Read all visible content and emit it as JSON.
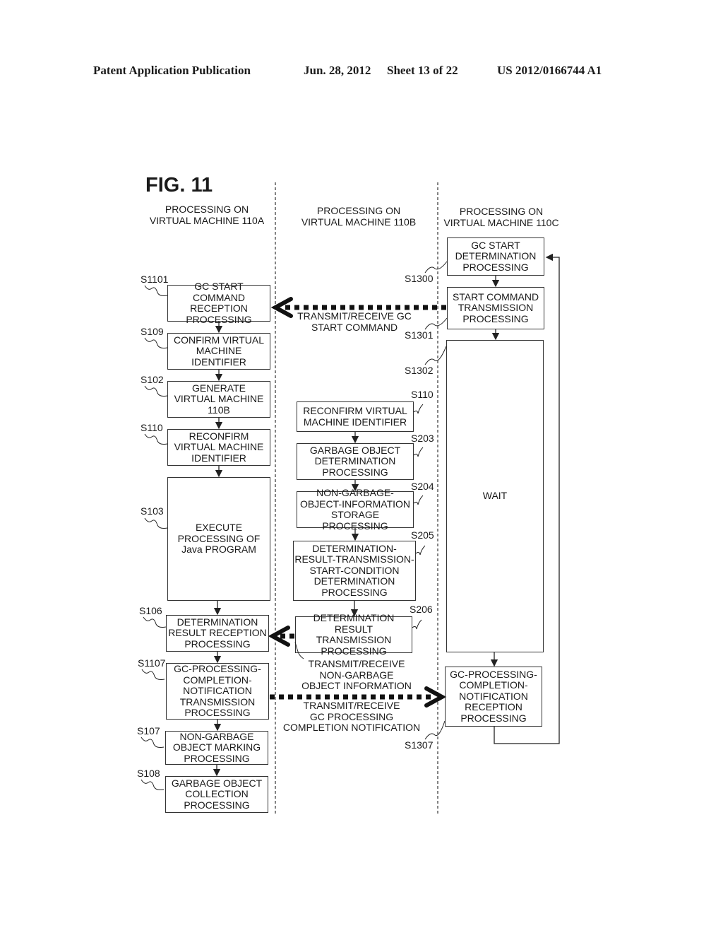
{
  "header": {
    "publication": "Patent Application Publication",
    "date": "Jun. 28, 2012",
    "sheet": "Sheet 13 of 22",
    "number": "US 2012/0166744 A1"
  },
  "figure": {
    "title": "FIG. 11"
  },
  "lanes": [
    {
      "title": "PROCESSING ON\nVIRTUAL MACHINE 110A"
    },
    {
      "title": "PROCESSING ON\nVIRTUAL MACHINE 110B"
    },
    {
      "title": "PROCESSING ON\nVIRTUAL MACHINE 110C"
    }
  ],
  "lane_a": [
    {
      "step": "S1101",
      "text": "GC START COMMAND\nRECEPTION\nPROCESSING"
    },
    {
      "step": "S109",
      "text": "CONFIRM VIRTUAL\nMACHINE\nIDENTIFIER"
    },
    {
      "step": "S102",
      "text": "GENERATE\nVIRTUAL MACHINE\n110B"
    },
    {
      "step": "S110",
      "text": "RECONFIRM\nVIRTUAL MACHINE\nIDENTIFIER"
    },
    {
      "step": "S103",
      "text": "EXECUTE\nPROCESSING OF\nJava PROGRAM"
    },
    {
      "step": "S106",
      "text": "DETERMINATION\nRESULT RECEPTION\nPROCESSING"
    },
    {
      "step": "S1107",
      "text": "GC-PROCESSING-\nCOMPLETION-\nNOTIFICATION\nTRANSMISSION\nPROCESSING"
    },
    {
      "step": "S107",
      "text": "NON-GARBAGE\nOBJECT MARKING\nPROCESSING"
    },
    {
      "step": "S108",
      "text": "GARBAGE OBJECT\nCOLLECTION\nPROCESSING"
    }
  ],
  "lane_b": [
    {
      "step": "S110",
      "text": "RECONFIRM VIRTUAL\nMACHINE IDENTIFIER"
    },
    {
      "step": "S203",
      "text": "GARBAGE OBJECT\nDETERMINATION\nPROCESSING"
    },
    {
      "step": "S204",
      "text": "NON-GARBAGE-\nOBJECT-INFORMATION\nSTORAGE PROCESSING"
    },
    {
      "step": "S205",
      "text": "DETERMINATION-\nRESULT-TRANSMISSION-\nSTART-CONDITION\nDETERMINATION\nPROCESSING"
    },
    {
      "step": "S206",
      "text": "DETERMINATION\nRESULT TRANSMISSION\nPROCESSING"
    }
  ],
  "lane_c": [
    {
      "step": "S1300",
      "text": "GC START\nDETERMINATION\nPROCESSING"
    },
    {
      "step": "S1301",
      "text": "START COMMAND\nTRANSMISSION\nPROCESSING"
    },
    {
      "step": "S1302",
      "text": "WAIT"
    },
    {
      "step": "S1307",
      "text": "GC-PROCESSING-\nCOMPLETION-\nNOTIFICATION\nRECEPTION\nPROCESSING"
    }
  ],
  "messages": [
    {
      "text": "TRANSMIT/RECEIVE GC\nSTART COMMAND"
    },
    {
      "text": "TRANSMIT/RECEIVE\nNON-GARBAGE\nOBJECT INFORMATION"
    },
    {
      "text": "TRANSMIT/RECEIVE\nGC PROCESSING\nCOMPLETION NOTIFICATION"
    }
  ]
}
